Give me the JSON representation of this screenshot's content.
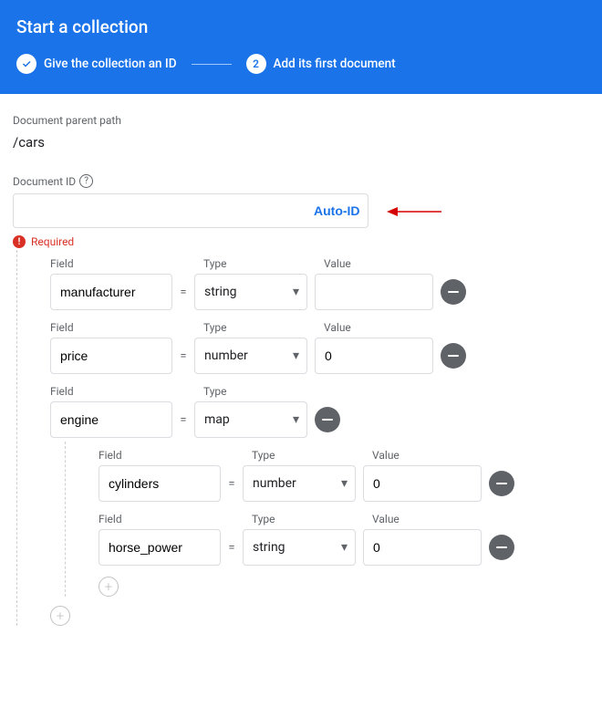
{
  "header": {
    "title": "Start a collection",
    "step1_label": "Give the collection an ID",
    "step2_label": "Add its first document",
    "step2_number": "2"
  },
  "parent_path": {
    "label": "Document parent path",
    "value": "/cars"
  },
  "doc_id": {
    "label": "Document ID",
    "auto_id_label": "Auto-ID",
    "value": "",
    "error": "Required"
  },
  "labels": {
    "field": "Field",
    "type": "Type",
    "value": "Value"
  },
  "fields": [
    {
      "name": "manufacturer",
      "type": "string",
      "value": ""
    },
    {
      "name": "price",
      "type": "number",
      "value": "0"
    },
    {
      "name": "engine",
      "type": "map",
      "children": [
        {
          "name": "cylinders",
          "type": "number",
          "value": "0"
        },
        {
          "name": "horse_power",
          "type": "string",
          "value": "0"
        }
      ]
    }
  ]
}
